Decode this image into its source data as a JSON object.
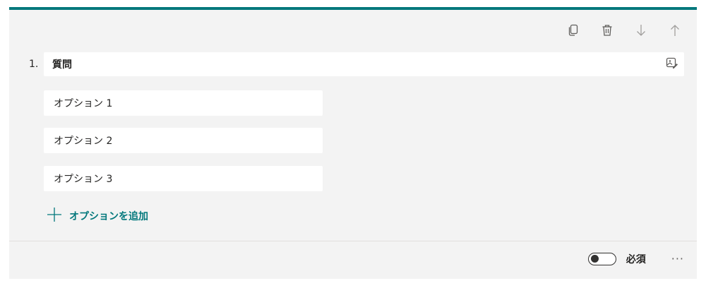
{
  "colors": {
    "accent": "#03787c",
    "card_background": "#f3f3f3",
    "text": "#252423",
    "icon_muted": "#a19f9d",
    "icon": "#605e5c"
  },
  "toolbar": {
    "icons": [
      "copy-icon",
      "trash-icon",
      "arrow-down-icon",
      "arrow-up-icon"
    ]
  },
  "question": {
    "number": "1.",
    "title": "質問",
    "media_icon": "insert-media-icon"
  },
  "options": [
    {
      "label": "オプション 1"
    },
    {
      "label": "オプション 2"
    },
    {
      "label": "オプション 3"
    }
  ],
  "add_option": {
    "icon": "plus-icon",
    "label": "オプションを追加"
  },
  "footer": {
    "required_label": "必須",
    "required_on": false,
    "more_label": "···"
  }
}
